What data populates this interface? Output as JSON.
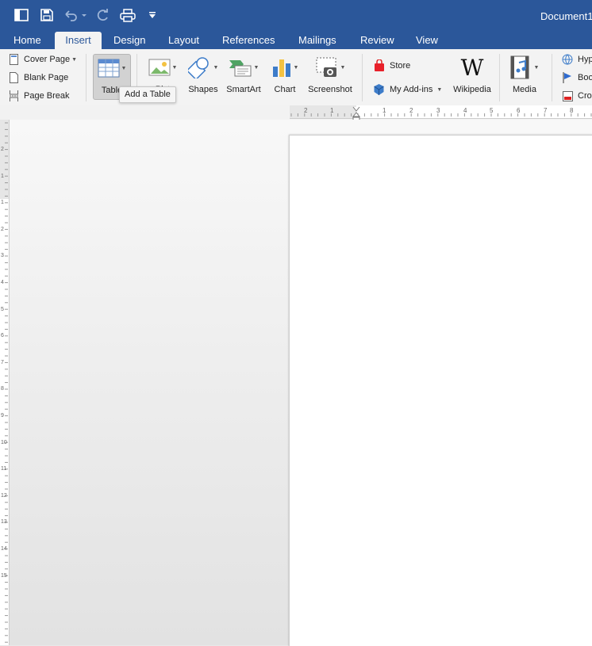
{
  "window": {
    "title": "Document1"
  },
  "qat": {
    "save": "save",
    "undo": "undo",
    "redo": "redo",
    "print": "print"
  },
  "tabs": [
    "Home",
    "Insert",
    "Design",
    "Layout",
    "References",
    "Mailings",
    "Review",
    "View"
  ],
  "active_tab": "Insert",
  "ribbon": {
    "pages": {
      "cover_page": "Cover Page",
      "blank_page": "Blank Page",
      "page_break": "Page Break"
    },
    "table": "Table",
    "pictures": "Pict",
    "shapes": "Shapes",
    "smartart": "SmartArt",
    "chart": "Chart",
    "screenshot": "Screenshot",
    "store": "Store",
    "my_addins": "My Add-ins",
    "wikipedia": "Wikipedia",
    "media": "Media",
    "hyperlink": "Hyp",
    "bookmark": "Boo",
    "crossref": "Cro"
  },
  "tooltip": "Add a Table",
  "hruler_labels": [
    "2",
    "1",
    "1",
    "2",
    "3",
    "4",
    "5",
    "6",
    "7",
    "8"
  ],
  "vruler_labels": [
    "2",
    "1",
    "1",
    "2",
    "3",
    "4",
    "5",
    "6",
    "7",
    "8",
    "9",
    "10",
    "11",
    "12",
    "13",
    "14",
    "15"
  ],
  "colors": {
    "accent": "#2b579a",
    "ribbon": "#f3f3f3"
  }
}
